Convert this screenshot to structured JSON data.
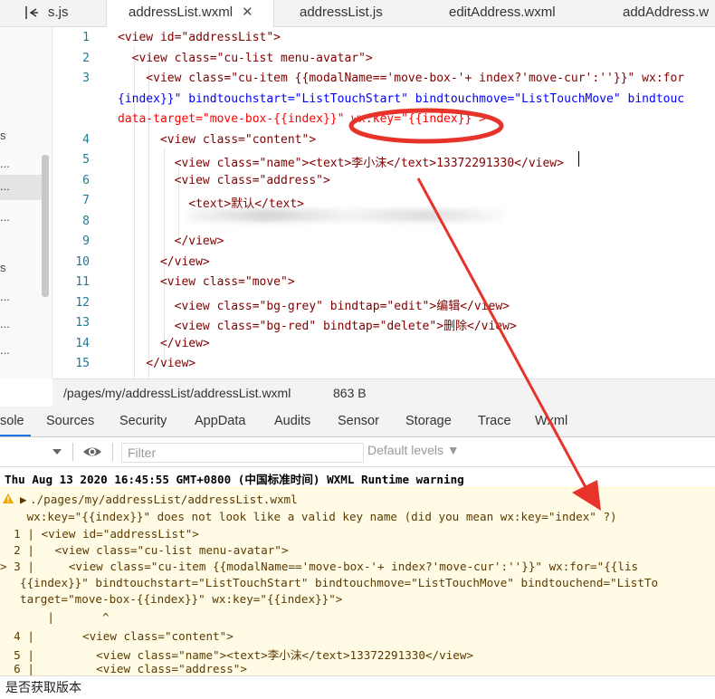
{
  "tabs": [
    {
      "label": "s.js"
    },
    {
      "label": "addressList.wxml",
      "active": true
    },
    {
      "label": "addressList.js"
    },
    {
      "label": "editAddress.wxml"
    },
    {
      "label": "addAddress.w"
    }
  ],
  "sidebar": {
    "items": [
      "s",
      "...",
      "...",
      "...",
      "s",
      "...",
      "...",
      "..."
    ]
  },
  "editor": {
    "lines": [
      {
        "n": "1"
      },
      {
        "n": "2"
      },
      {
        "n": "3"
      },
      {
        "n": "4"
      },
      {
        "n": "5"
      },
      {
        "n": "6"
      },
      {
        "n": "7"
      },
      {
        "n": "8"
      },
      {
        "n": "9"
      },
      {
        "n": "10"
      },
      {
        "n": "11"
      },
      {
        "n": "12"
      },
      {
        "n": "13"
      },
      {
        "n": "14"
      },
      {
        "n": "15"
      }
    ],
    "code": {
      "l1": "<view id=\"addressList\">",
      "l2": "  <view class=\"cu-list menu-avatar\">",
      "l3": "    <view class=\"cu-item {{modalName=='move-box-'+ index?'move-cur':''}}\" wx:for",
      "l3b": "{index}}\" bindtouchstart=\"ListTouchStart\" bindtouchmove=\"ListTouchMove\" bindtouc",
      "l3c": "data-target=\"move-box-{{index}}\" wx:key=\"{{index}}\">",
      "l4": "      <view class=\"content\">",
      "l5": "        <view class=\"name\"><text>李小沫</text>13372291330</view>",
      "l6": "        <view class=\"address\">",
      "l7": "          <text>默认</text>",
      "l9": "        </view>",
      "l10": "      </view>",
      "l11": "      <view class=\"move\">",
      "l12": "        <view class=\"bg-grey\" bindtap=\"edit\">编辑</view>",
      "l13": "        <view class=\"bg-red\" bindtap=\"delete\">删除</view>",
      "l14": "      </view>",
      "l15": "    </view>"
    }
  },
  "filebar": {
    "path": "/pages/my/addressList/addressList.wxml",
    "size": "863 B"
  },
  "devtools": {
    "tabs": [
      "sole",
      "Sources",
      "Security",
      "AppData",
      "Audits",
      "Sensor",
      "Storage",
      "Trace",
      "Wxml"
    ],
    "filter_placeholder": "Filter",
    "levels": "Default levels ▼"
  },
  "console": {
    "header": "Thu Aug 13 2020 16:45:55 GMT+0800 (中国标准时间) WXML Runtime warning",
    "file": "./pages/my/addressList/addressList.wxml",
    "message": " wx:key=\"{{index}}\" does not look like a valid key name (did you mean wx:key=\"index\" ?)",
    "snippet": [
      "  1 | <view id=\"addressList\">",
      "  2 |   <view class=\"cu-list menu-avatar\">",
      "> 3 |     <view class=\"cu-item {{modalName=='move-box-'+ index?'move-cur':''}}\" wx:for=\"{{lis",
      "{{index}}\" bindtouchstart=\"ListTouchStart\" bindtouchmove=\"ListTouchMove\" bindtouchend=\"ListTo",
      "target=\"move-box-{{index}}\" wx:key=\"{{index}}\">",
      "    |       ^",
      "  4 |       <view class=\"content\">",
      "  5 |         <view class=\"name\"><text>李小沫</text>13372291330</view>",
      "  6 |         <view class=\"address\">"
    ]
  },
  "bottombar": {
    "text": "是否获取版本"
  },
  "colors": {
    "annotation": "#e8332a",
    "accent": "#1a73e8"
  }
}
